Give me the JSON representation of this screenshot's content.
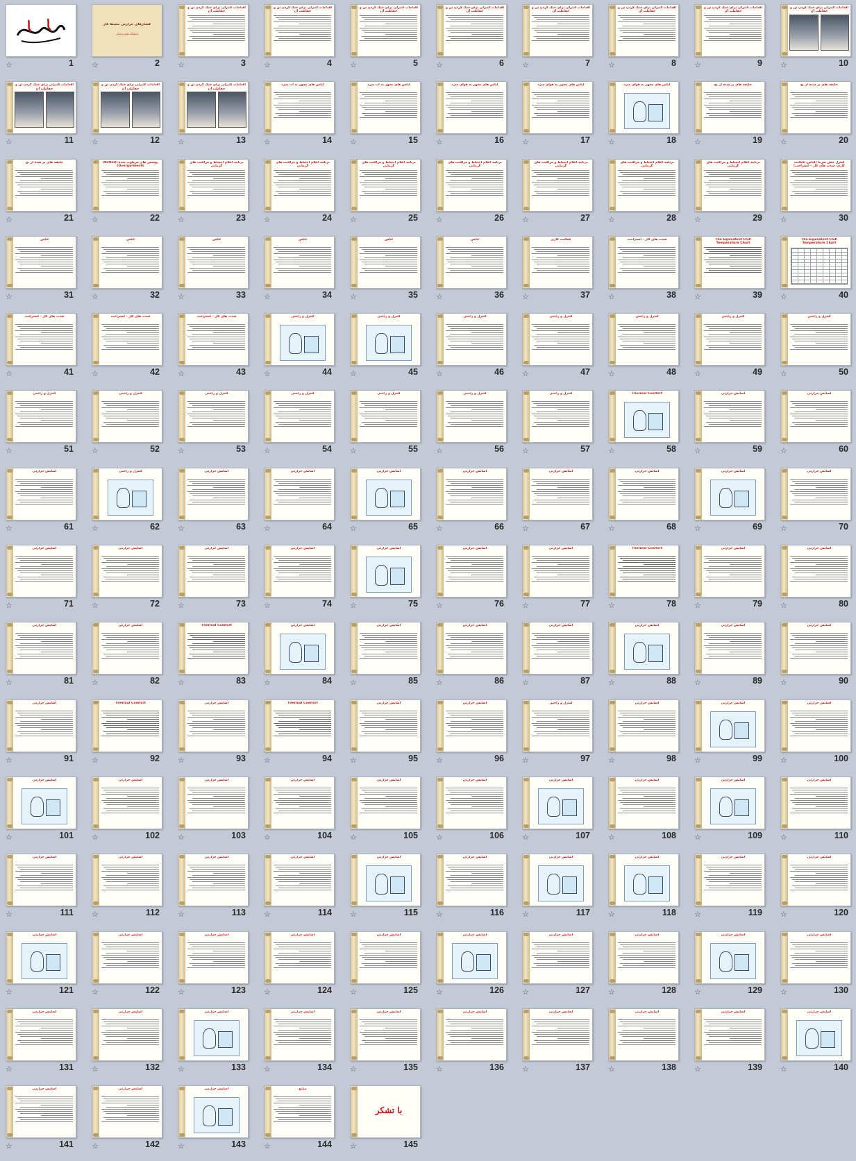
{
  "view": "slide-sorter",
  "icons": {
    "transition": "star-outline-icon"
  },
  "colors": {
    "background": "#c3cad6",
    "title": "#d11c1c",
    "scroll": "#e6d6a8"
  },
  "slides": [
    {
      "number": "1",
      "kind": "cover",
      "title": ""
    },
    {
      "number": "2",
      "kind": "tan",
      "title": "فشارهای حرارتی محیط کار",
      "subtitle": "دانشگاه علوم پزشکی"
    },
    {
      "number": "3",
      "kind": "text",
      "title": "اقدامات کنترلی برای خنک کردن تن و حفاظت آن"
    },
    {
      "number": "4",
      "kind": "text",
      "title": "اقدامات کنترلی برای خنک کردن تن و حفاظت آن"
    },
    {
      "number": "5",
      "kind": "text",
      "title": "اقدامات کنترلی برای خنک کردن تن و حفاظت آن"
    },
    {
      "number": "6",
      "kind": "text",
      "title": "اقدامات کنترلی برای خنک کردن تن و حفاظت آن"
    },
    {
      "number": "7",
      "kind": "text",
      "title": "اقدامات کنترلی برای خنک کردن تن و حفاظت آن"
    },
    {
      "number": "8",
      "kind": "text",
      "title": "اقدامات کنترلی برای خنک کردن تن و حفاظت آن"
    },
    {
      "number": "9",
      "kind": "text",
      "title": "اقدامات کنترلی برای خنک کردن تن و حفاظت آن"
    },
    {
      "number": "10",
      "kind": "photos",
      "title": "اقدامات کنترلی برای خنک کردن تن و حفاظت آن"
    },
    {
      "number": "11",
      "kind": "photos",
      "title": "اقدامات کنترلی برای خنک کردن تن و حفاظت آن"
    },
    {
      "number": "12",
      "kind": "photos",
      "title": "اقدامات کنترلی برای خنک کردن تن و حفاظت آن"
    },
    {
      "number": "13",
      "kind": "photos",
      "title": "اقدامات کنترلی برای خنک کردن تن و حفاظت آن"
    },
    {
      "number": "14",
      "kind": "text",
      "title": "لباس های مجهز به آب سرد"
    },
    {
      "number": "15",
      "kind": "text",
      "title": "لباس های مجهز به آب سرد"
    },
    {
      "number": "16",
      "kind": "text",
      "title": "لباس های مجهز به هوای سرد"
    },
    {
      "number": "17",
      "kind": "text",
      "title": "لباس های مجهز به هوای سرد"
    },
    {
      "number": "18",
      "kind": "pic",
      "title": "لباس های مجهز به هوای سرد"
    },
    {
      "number": "19",
      "kind": "text",
      "title": "جلیقه های پر شده از یخ"
    },
    {
      "number": "20",
      "kind": "text",
      "title": "جلیقه های پر شده از یخ"
    },
    {
      "number": "21",
      "kind": "text",
      "title": "جلیقه های پر شده از یخ"
    },
    {
      "number": "22",
      "kind": "text",
      "title": "پوشش های مرطوب شده (Wetted Overgarments)"
    },
    {
      "number": "23",
      "kind": "text",
      "title": "برنامه اعلام احتیاط و مراقبت های گرمایی"
    },
    {
      "number": "24",
      "kind": "text",
      "title": "برنامه اعلام احتیاط و مراقبت های گرمایی"
    },
    {
      "number": "25",
      "kind": "text",
      "title": "برنامه اعلام احتیاط و مراقبت های گرمایی"
    },
    {
      "number": "26",
      "kind": "text",
      "title": "برنامه اعلام احتیاط و مراقبت های گرمایی"
    },
    {
      "number": "27",
      "kind": "text",
      "title": "برنامه اعلام احتیاط و مراقبت های گرمایی"
    },
    {
      "number": "28",
      "kind": "text",
      "title": "برنامه اعلام احتیاط و مراقبت های گرمایی"
    },
    {
      "number": "29",
      "kind": "text",
      "title": "برنامه اعلام احتیاط و مراقبت های گرمایی"
    },
    {
      "number": "30",
      "kind": "text",
      "title": "کنترل تنش سرما (لباس، فعالیت کاری، شدت های کار – استراحت)"
    },
    {
      "number": "31",
      "kind": "text",
      "title": "لباس"
    },
    {
      "number": "32",
      "kind": "text",
      "title": "لباس"
    },
    {
      "number": "33",
      "kind": "text",
      "title": "لباس"
    },
    {
      "number": "34",
      "kind": "text",
      "title": "لباس"
    },
    {
      "number": "35",
      "kind": "text",
      "title": "لباس"
    },
    {
      "number": "36",
      "kind": "text",
      "title": "لباس"
    },
    {
      "number": "37",
      "kind": "text",
      "title": "فعالیت کاری"
    },
    {
      "number": "38",
      "kind": "text",
      "title": "شدت های کار – استراحت"
    },
    {
      "number": "39",
      "kind": "en",
      "title": "The Equivalent Chill Temperature Chart"
    },
    {
      "number": "40",
      "kind": "table",
      "title": "The Equivalent Chill Temperature Chart"
    },
    {
      "number": "41",
      "kind": "text",
      "title": "شدت های کار – استراحت"
    },
    {
      "number": "42",
      "kind": "text",
      "title": "شدت های کار – استراحت"
    },
    {
      "number": "43",
      "kind": "text",
      "title": "شدت های کار – استراحت"
    },
    {
      "number": "44",
      "kind": "pic",
      "title": "کنترل و راحتی"
    },
    {
      "number": "45",
      "kind": "pic",
      "title": "کنترل و راحتی"
    },
    {
      "number": "46",
      "kind": "text",
      "title": "کنترل و راحتی"
    },
    {
      "number": "47",
      "kind": "text",
      "title": "کنترل و راحتی"
    },
    {
      "number": "48",
      "kind": "text",
      "title": "کنترل و راحتی"
    },
    {
      "number": "49",
      "kind": "text",
      "title": "کنترل و راحتی"
    },
    {
      "number": "50",
      "kind": "text",
      "title": "کنترل و راحتی"
    },
    {
      "number": "51",
      "kind": "text",
      "title": "کنترل و راحتی"
    },
    {
      "number": "52",
      "kind": "text",
      "title": "کنترل و راحتی"
    },
    {
      "number": "53",
      "kind": "text",
      "title": "کنترل و راحتی"
    },
    {
      "number": "54",
      "kind": "text",
      "title": "کنترل و راحتی"
    },
    {
      "number": "55",
      "kind": "text",
      "title": "کنترل و راحتی"
    },
    {
      "number": "56",
      "kind": "text",
      "title": "کنترل و راحتی"
    },
    {
      "number": "57",
      "kind": "text",
      "title": "کنترل و راحتی"
    },
    {
      "number": "58",
      "kind": "pic",
      "title": "Thermal Comfort"
    },
    {
      "number": "59",
      "kind": "text",
      "title": "آسایش حرارتی"
    },
    {
      "number": "60",
      "kind": "text",
      "title": "آسایش حرارتی"
    },
    {
      "number": "61",
      "kind": "text",
      "title": "آسایش حرارتی"
    },
    {
      "number": "62",
      "kind": "pic",
      "title": "کنترل و راحتی"
    },
    {
      "number": "63",
      "kind": "text",
      "title": "آسایش حرارتی"
    },
    {
      "number": "64",
      "kind": "text",
      "title": "آسایش حرارتی"
    },
    {
      "number": "65",
      "kind": "pic",
      "title": "آسایش حرارتی"
    },
    {
      "number": "66",
      "kind": "text",
      "title": "آسایش حرارتی"
    },
    {
      "number": "67",
      "kind": "text",
      "title": "آسایش حرارتی"
    },
    {
      "number": "68",
      "kind": "text",
      "title": "آسایش حرارتی"
    },
    {
      "number": "69",
      "kind": "pic",
      "title": "آسایش حرارتی"
    },
    {
      "number": "70",
      "kind": "text",
      "title": "آسایش حرارتی"
    },
    {
      "number": "71",
      "kind": "text",
      "title": "آسایش حرارتی"
    },
    {
      "number": "72",
      "kind": "text",
      "title": "آسایش حرارتی"
    },
    {
      "number": "73",
      "kind": "text",
      "title": "آسایش حرارتی"
    },
    {
      "number": "74",
      "kind": "text",
      "title": "آسایش حرارتی"
    },
    {
      "number": "75",
      "kind": "pic",
      "title": "آسایش حرارتی"
    },
    {
      "number": "76",
      "kind": "text",
      "title": "آسایش حرارتی"
    },
    {
      "number": "77",
      "kind": "text",
      "title": "آسایش حرارتی"
    },
    {
      "number": "78",
      "kind": "en",
      "title": "Thermal Comfort"
    },
    {
      "number": "79",
      "kind": "text",
      "title": "آسایش حرارتی"
    },
    {
      "number": "80",
      "kind": "text",
      "title": "آسایش حرارتی"
    },
    {
      "number": "81",
      "kind": "text",
      "title": "آسایش حرارتی"
    },
    {
      "number": "82",
      "kind": "text",
      "title": "آسایش حرارتی"
    },
    {
      "number": "83",
      "kind": "en",
      "title": "Thermal Comfort"
    },
    {
      "number": "84",
      "kind": "pic",
      "title": "آسایش حرارتی"
    },
    {
      "number": "85",
      "kind": "text",
      "title": "آسایش حرارتی"
    },
    {
      "number": "86",
      "kind": "text",
      "title": "آسایش حرارتی"
    },
    {
      "number": "87",
      "kind": "text",
      "title": "آسایش حرارتی"
    },
    {
      "number": "88",
      "kind": "pic",
      "title": "آسایش حرارتی"
    },
    {
      "number": "89",
      "kind": "text",
      "title": "آسایش حرارتی"
    },
    {
      "number": "90",
      "kind": "text",
      "title": "آسایش حرارتی"
    },
    {
      "number": "91",
      "kind": "text",
      "title": "آسایش حرارتی"
    },
    {
      "number": "92",
      "kind": "en",
      "title": "Thermal Comfort"
    },
    {
      "number": "93",
      "kind": "text",
      "title": "آسایش حرارتی"
    },
    {
      "number": "94",
      "kind": "en",
      "title": "Thermal Comfort"
    },
    {
      "number": "95",
      "kind": "text",
      "title": "آسایش حرارتی"
    },
    {
      "number": "96",
      "kind": "text",
      "title": "آسایش حرارتی"
    },
    {
      "number": "97",
      "kind": "text",
      "title": "کنترل و راحتی"
    },
    {
      "number": "98",
      "kind": "text",
      "title": "آسایش حرارتی"
    },
    {
      "number": "99",
      "kind": "pic",
      "title": "آسایش حرارتی"
    },
    {
      "number": "100",
      "kind": "text",
      "title": "آسایش حرارتی"
    },
    {
      "number": "101",
      "kind": "pic",
      "title": "آسایش حرارتی"
    },
    {
      "number": "102",
      "kind": "text",
      "title": "آسایش حرارتی"
    },
    {
      "number": "103",
      "kind": "text",
      "title": "آسایش حرارتی"
    },
    {
      "number": "104",
      "kind": "text",
      "title": "آسایش حرارتی"
    },
    {
      "number": "105",
      "kind": "text",
      "title": "آسایش حرارتی"
    },
    {
      "number": "106",
      "kind": "text",
      "title": "آسایش حرارتی"
    },
    {
      "number": "107",
      "kind": "pic",
      "title": "آسایش حرارتی"
    },
    {
      "number": "108",
      "kind": "text",
      "title": "آسایش حرارتی"
    },
    {
      "number": "109",
      "kind": "pic",
      "title": "آسایش حرارتی"
    },
    {
      "number": "110",
      "kind": "text",
      "title": "آسایش حرارتی"
    },
    {
      "number": "111",
      "kind": "text",
      "title": "آسایش حرارتی"
    },
    {
      "number": "112",
      "kind": "text",
      "title": "آسایش حرارتی"
    },
    {
      "number": "113",
      "kind": "text",
      "title": "آسایش حرارتی"
    },
    {
      "number": "114",
      "kind": "text",
      "title": "آسایش حرارتی"
    },
    {
      "number": "115",
      "kind": "pic",
      "title": "آسایش حرارتی"
    },
    {
      "number": "116",
      "kind": "text",
      "title": "آسایش حرارتی"
    },
    {
      "number": "117",
      "kind": "pic",
      "title": "آسایش حرارتی"
    },
    {
      "number": "118",
      "kind": "pic",
      "title": "آسایش حرارتی"
    },
    {
      "number": "119",
      "kind": "text",
      "title": "آسایش حرارتی"
    },
    {
      "number": "120",
      "kind": "text",
      "title": "آسایش حرارتی"
    },
    {
      "number": "121",
      "kind": "pic",
      "title": "آسایش حرارتی"
    },
    {
      "number": "122",
      "kind": "text",
      "title": "آسایش حرارتی"
    },
    {
      "number": "123",
      "kind": "text",
      "title": "آسایش حرارتی"
    },
    {
      "number": "124",
      "kind": "text",
      "title": "آسایش حرارتی"
    },
    {
      "number": "125",
      "kind": "text",
      "title": "آسایش حرارتی"
    },
    {
      "number": "126",
      "kind": "pic",
      "title": "آسایش حرارتی"
    },
    {
      "number": "127",
      "kind": "text",
      "title": "آسایش حرارتی"
    },
    {
      "number": "128",
      "kind": "text",
      "title": "آسایش حرارتی"
    },
    {
      "number": "129",
      "kind": "pic",
      "title": "آسایش حرارتی"
    },
    {
      "number": "130",
      "kind": "text",
      "title": "آسایش حرارتی"
    },
    {
      "number": "131",
      "kind": "text",
      "title": "آسایش حرارتی"
    },
    {
      "number": "132",
      "kind": "text",
      "title": "آسایش حرارتی"
    },
    {
      "number": "133",
      "kind": "pic",
      "title": "آسایش حرارتی"
    },
    {
      "number": "134",
      "kind": "text",
      "title": "آسایش حرارتی"
    },
    {
      "number": "135",
      "kind": "text",
      "title": "آسایش حرارتی"
    },
    {
      "number": "136",
      "kind": "text",
      "title": "آسایش حرارتی"
    },
    {
      "number": "137",
      "kind": "text",
      "title": "آسایش حرارتی"
    },
    {
      "number": "138",
      "kind": "text",
      "title": "آسایش حرارتی"
    },
    {
      "number": "139",
      "kind": "text",
      "title": "آسایش حرارتی"
    },
    {
      "number": "140",
      "kind": "pic",
      "title": "آسایش حرارتی"
    },
    {
      "number": "141",
      "kind": "text",
      "title": "آسایش حرارتی"
    },
    {
      "number": "142",
      "kind": "text",
      "title": "آسایش حرارتی"
    },
    {
      "number": "143",
      "kind": "pic",
      "title": "آسایش حرارتی"
    },
    {
      "number": "144",
      "kind": "text",
      "title": "منابع"
    },
    {
      "number": "145",
      "kind": "thanks",
      "title": "",
      "text": "با تشکر"
    }
  ]
}
